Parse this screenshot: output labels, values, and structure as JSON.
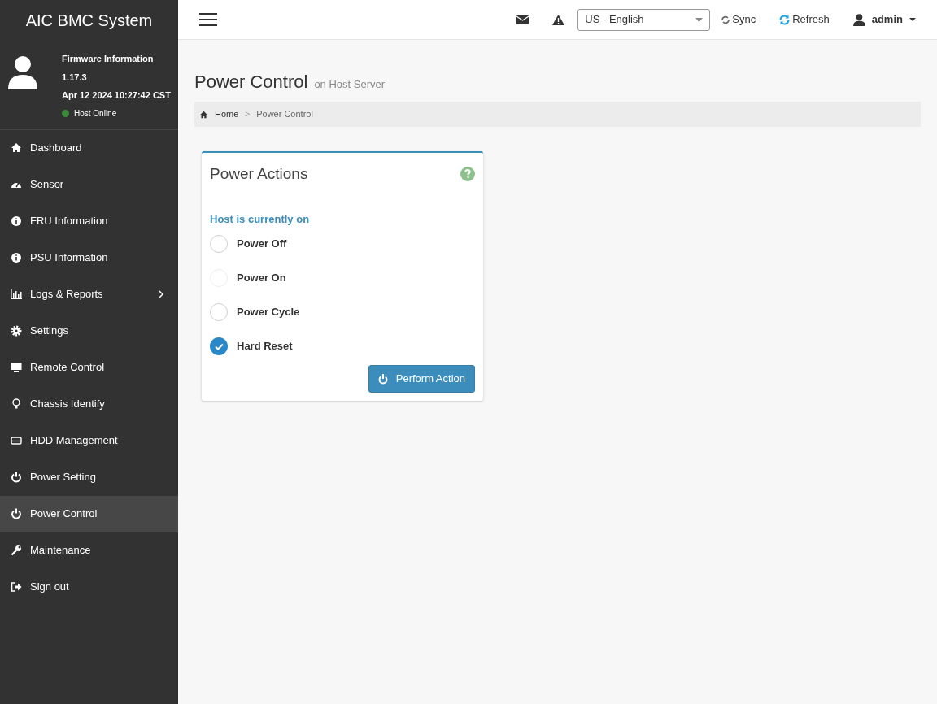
{
  "sidebar": {
    "title": "AIC BMC System",
    "firmware_link": "Firmware Information",
    "version": "1.17.3",
    "build_date": "Apr 12 2024 10:27:42 CST",
    "host_status": {
      "label": "Host Online",
      "color": "#3c8b3c"
    },
    "items": [
      {
        "label": "Dashboard",
        "kind": "home",
        "selected": false,
        "has_submenu": false
      },
      {
        "label": "Sensor",
        "kind": "gauge",
        "selected": false,
        "has_submenu": false
      },
      {
        "label": "FRU Information",
        "kind": "info",
        "selected": false,
        "has_submenu": false
      },
      {
        "label": "PSU Information",
        "kind": "info",
        "selected": false,
        "has_submenu": false
      },
      {
        "label": "Logs & Reports",
        "kind": "chart",
        "selected": false,
        "has_submenu": true
      },
      {
        "label": "Settings",
        "kind": "gear",
        "selected": false,
        "has_submenu": false
      },
      {
        "label": "Remote Control",
        "kind": "monitor",
        "selected": false,
        "has_submenu": false
      },
      {
        "label": "Chassis Identify",
        "kind": "bulb",
        "selected": false,
        "has_submenu": false
      },
      {
        "label": "HDD Management",
        "kind": "drive",
        "selected": false,
        "has_submenu": false
      },
      {
        "label": "Power Setting",
        "kind": "power",
        "selected": false,
        "has_submenu": false
      },
      {
        "label": "Power Control",
        "kind": "power",
        "selected": true,
        "has_submenu": false
      },
      {
        "label": "Maintenance",
        "kind": "wrench",
        "selected": false,
        "has_submenu": false
      },
      {
        "label": "Sign out",
        "kind": "signout",
        "selected": false,
        "has_submenu": false
      }
    ]
  },
  "topbar": {
    "language": "US - English",
    "sync": "Sync",
    "refresh": "Refresh",
    "user": "admin"
  },
  "page": {
    "title": "Power Control",
    "subtitle": "on Host Server",
    "breadcrumb_separator": ">",
    "breadcrumb": [
      {
        "label": "Home"
      },
      {
        "label": "Power Control"
      }
    ]
  },
  "panel": {
    "title": "Power Actions",
    "status": "Host is currently on",
    "options": [
      {
        "label": "Power Off",
        "selected": false,
        "disabled": false
      },
      {
        "label": "Power On",
        "selected": false,
        "disabled": true
      },
      {
        "label": "Power Cycle",
        "selected": false,
        "disabled": false
      },
      {
        "label": "Hard Reset",
        "selected": true,
        "disabled": false
      }
    ],
    "button": "Perform Action"
  }
}
